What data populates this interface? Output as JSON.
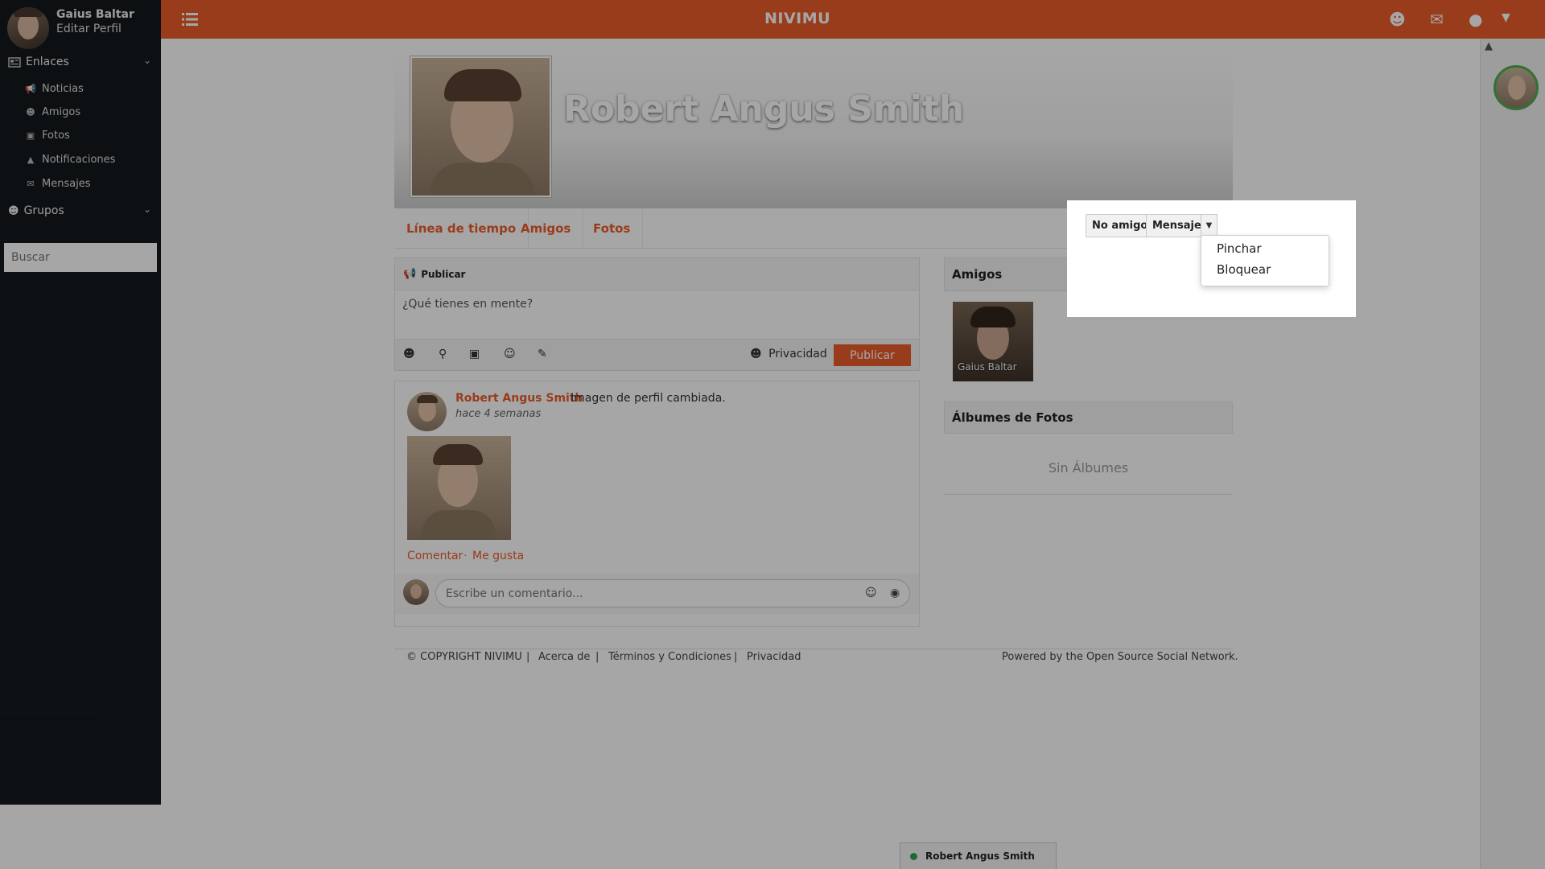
{
  "app": {
    "brand": "NIVIMU"
  },
  "sidebar": {
    "user_name": "Gaius Baltar",
    "edit_profile": "Editar Perfil",
    "links_section": "Enlaces",
    "items": [
      {
        "label": "Noticias",
        "icon": "megaphone-icon"
      },
      {
        "label": "Amigos",
        "icon": "users-icon"
      },
      {
        "label": "Fotos",
        "icon": "image-icon"
      },
      {
        "label": "Notificaciones",
        "icon": "bell-icon"
      },
      {
        "label": "Mensajes",
        "icon": "envelope-icon"
      }
    ],
    "groups_section": "Grupos",
    "search_placeholder": "Buscar"
  },
  "profile": {
    "name": "Robert Angus Smith",
    "tabs": [
      "Línea de tiempo",
      "Amigos",
      "Fotos"
    ]
  },
  "publish": {
    "header": "Publicar",
    "placeholder": "¿Qué tienes en mente?",
    "privacy": "Privacidad",
    "button": "Publicar"
  },
  "post": {
    "author": "Robert Angus Smith",
    "text": "Imagen de perfil cambiada.",
    "time": "hace 4 semanas",
    "comment_link": "Comentar",
    "separator": "·",
    "like_link": "Me gusta",
    "comment_placeholder": "Escribe un comentario..."
  },
  "friends": {
    "title": "Amigos",
    "items": [
      {
        "name": "Gaius Baltar"
      }
    ]
  },
  "albums": {
    "title": "Álbumes de Fotos",
    "empty": "Sin Álbumes"
  },
  "footer": {
    "copyright": "© COPYRIGHT NIVIMU",
    "sep": "|",
    "about": "Acerca de",
    "terms": "Términos y Condiciones",
    "privacy": "Privacidad",
    "powered": "Powered by the Open Source Social Network."
  },
  "chat": {
    "name": "Robert Angus Smith",
    "status_color": "#2ea44f"
  },
  "popup": {
    "unfriend_button": "No amigo",
    "message_button": "Mensaje",
    "menu": [
      "Pinchar",
      "Bloquear"
    ]
  },
  "colors": {
    "accent": "#eb5c2c",
    "sidebar": "#151a1d"
  }
}
